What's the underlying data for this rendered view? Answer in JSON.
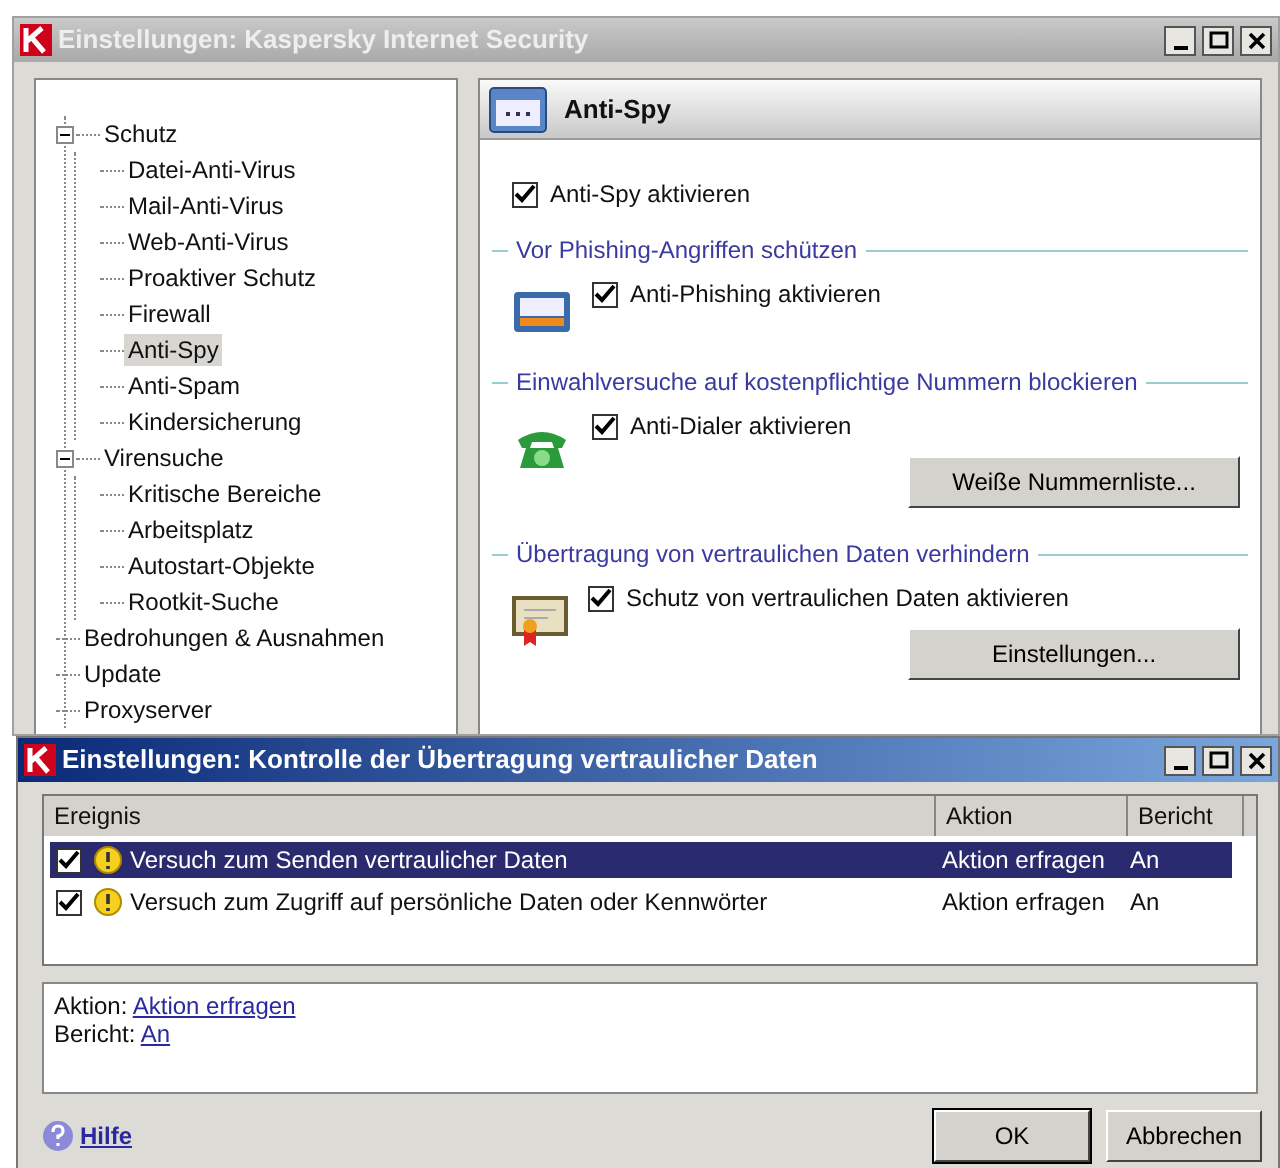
{
  "window": {
    "title": "Einstellungen: Kaspersky Internet Security"
  },
  "tree": [
    {
      "label": "Schutz",
      "expanded": true,
      "selected": false,
      "children": [
        {
          "label": "Datei-Anti-Virus",
          "selected": false
        },
        {
          "label": "Mail-Anti-Virus",
          "selected": false
        },
        {
          "label": "Web-Anti-Virus",
          "selected": false
        },
        {
          "label": "Proaktiver Schutz",
          "selected": false
        },
        {
          "label": "Firewall",
          "selected": false
        },
        {
          "label": "Anti-Spy",
          "selected": true
        },
        {
          "label": "Anti-Spam",
          "selected": false
        },
        {
          "label": "Kindersicherung",
          "selected": false
        }
      ]
    },
    {
      "label": "Virensuche",
      "expanded": true,
      "selected": false,
      "children": [
        {
          "label": "Kritische Bereiche",
          "selected": false
        },
        {
          "label": "Arbeitsplatz",
          "selected": false
        },
        {
          "label": "Autostart-Objekte",
          "selected": false
        },
        {
          "label": "Rootkit-Suche",
          "selected": false
        }
      ]
    },
    {
      "label": "Bedrohungen & Ausnahmen",
      "selected": false
    },
    {
      "label": "Update",
      "selected": false
    },
    {
      "label": "Proxyserver",
      "selected": false
    }
  ],
  "panel": {
    "title": "Anti-Spy",
    "enable": {
      "label": "Anti-Spy aktivieren",
      "checked": true
    },
    "sections": [
      {
        "title": "Vor Phishing-Angriffen schützen",
        "kind": "card",
        "checkbox": {
          "label": "Anti-Phishing aktivieren",
          "checked": true
        }
      },
      {
        "title": "Einwahlversuche auf kostenpflichtige Nummern blockieren",
        "kind": "phone",
        "checkbox": {
          "label": "Anti-Dialer aktivieren",
          "checked": true
        },
        "button": "Weiße Nummernliste..."
      },
      {
        "title": "Übertragung von vertraulichen Daten verhindern",
        "kind": "certificate",
        "checkbox": {
          "label": "Schutz von vertraulichen Daten aktivieren",
          "checked": true
        },
        "button": "Einstellungen..."
      }
    ]
  },
  "dialog": {
    "title": "Einstellungen: Kontrolle der Übertragung vertraulicher Daten",
    "columns": [
      "Ereignis",
      "Aktion",
      "Bericht"
    ],
    "rows": [
      {
        "checked": true,
        "selected": true,
        "event": "Versuch zum Senden vertraulicher Daten",
        "action": "Aktion erfragen",
        "report": "An"
      },
      {
        "checked": true,
        "selected": false,
        "event": "Versuch zum Zugriff auf persönliche Daten oder Kennwörter",
        "action": "Aktion erfragen",
        "report": "An"
      }
    ],
    "details": [
      {
        "label": "Aktion:",
        "link": "Aktion erfragen"
      },
      {
        "label": "Bericht:",
        "link": "An"
      }
    ],
    "help": "Hilfe",
    "buttons": [
      "OK",
      "Abbrechen"
    ]
  }
}
